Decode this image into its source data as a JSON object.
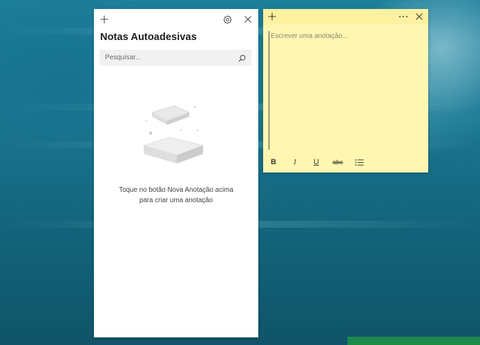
{
  "list_panel": {
    "title": "Notas Autoadesivas",
    "search": {
      "placeholder": "Pesquisar...",
      "value": ""
    },
    "empty_state": {
      "line1": "Toque no botão Nova Anotação acima",
      "line2": "para criar uma anotação"
    },
    "icons": {
      "new_note": "plus-icon",
      "settings": "gear-icon",
      "close": "close-icon",
      "search": "search-icon"
    }
  },
  "sticky_note": {
    "placeholder": "Escrever uma anotação...",
    "value": "",
    "color": "#fff7b1",
    "header_color": "#fff1a0",
    "toolbar": {
      "bold": "B",
      "italic": "I",
      "underline": "U",
      "strikethrough": "abc"
    },
    "icons": {
      "new_note": "plus-icon",
      "menu": "more-icon",
      "close": "close-icon",
      "bullets": "bullet-list-icon"
    }
  }
}
